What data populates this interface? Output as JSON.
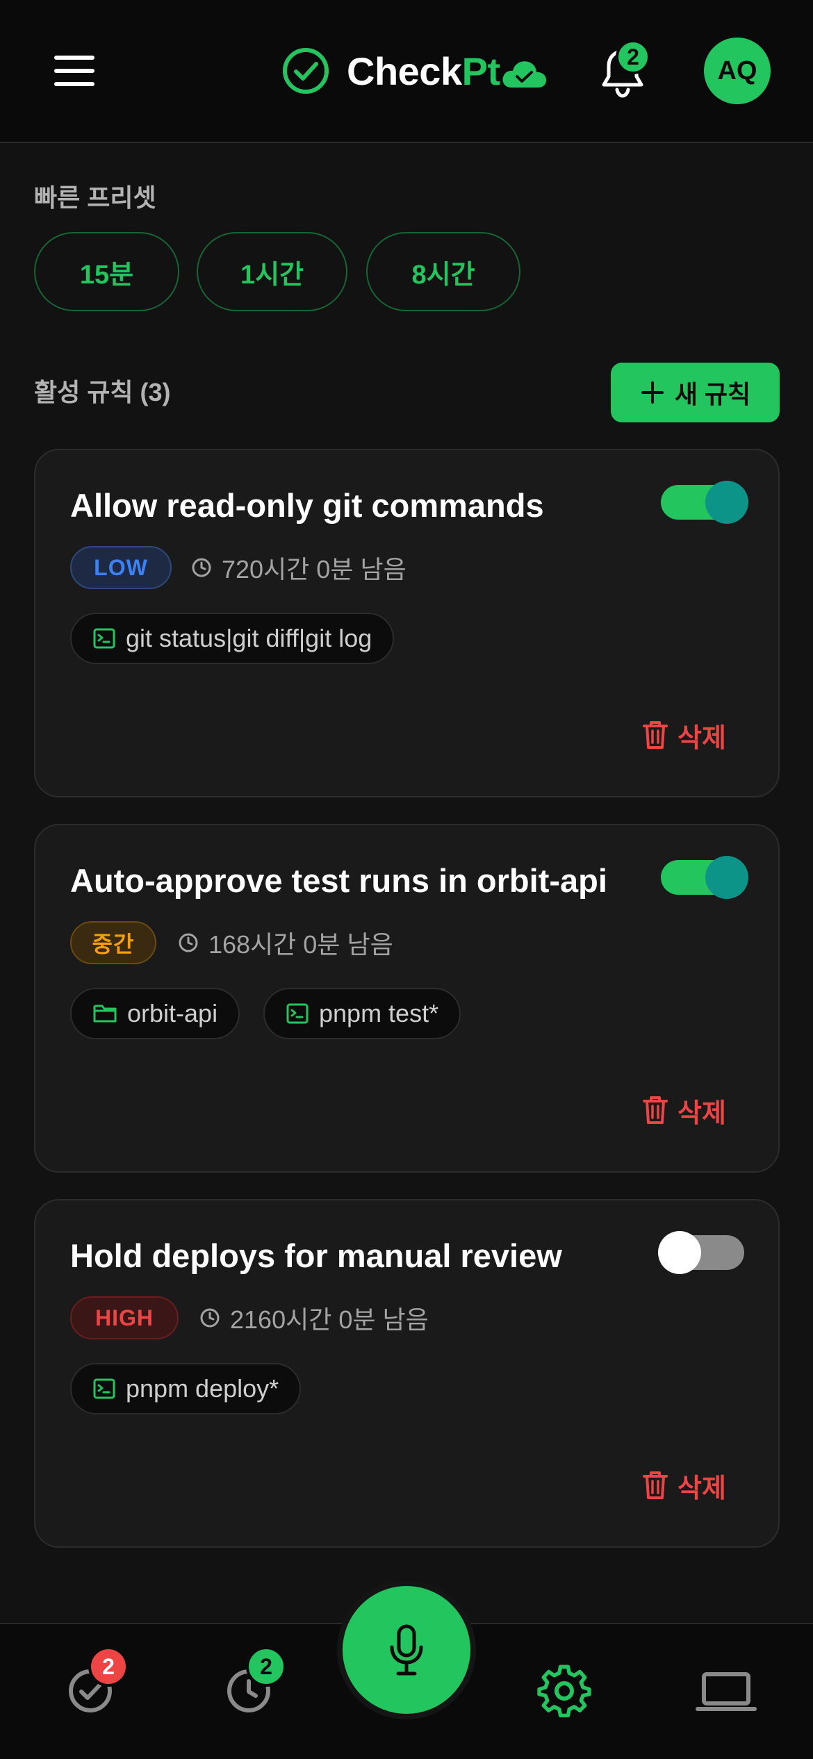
{
  "header": {
    "brand_check": "Check",
    "brand_pt": "Pt",
    "notification_count": "2",
    "avatar_initials": "AQ"
  },
  "presets": {
    "label": "빠른 프리셋",
    "items": [
      "15분",
      "1시간",
      "8시간"
    ]
  },
  "rules": {
    "label": "활성 규칙 (3)",
    "new_rule_label": "새 규칙",
    "items": [
      {
        "title": "Allow read-only git commands",
        "enabled": true,
        "risk": "LOW",
        "remaining": "720시간 0분 남음",
        "chips": [
          "git status|git diff|git log"
        ],
        "delete_label": "삭제"
      },
      {
        "title": "Auto-approve test runs in orbit-api",
        "enabled": true,
        "risk": "중간",
        "remaining": "168시간 0분 남음",
        "chips": [
          "orbit-api",
          "pnpm test*"
        ],
        "delete_label": "삭제"
      },
      {
        "title": "Hold deploys for manual review",
        "enabled": false,
        "risk": "HIGH",
        "remaining": "2160시간 0분 남음",
        "chips": [
          "pnpm deploy*"
        ],
        "delete_label": "삭제"
      }
    ]
  },
  "bottom_nav": {
    "approvals_badge": "2",
    "history_badge": "2"
  },
  "colors": {
    "accent": "#22c55e",
    "background": "#121212",
    "card": "#1a1a1a",
    "low": "#3b82f6",
    "medium": "#f59e0b",
    "high": "#ef4444",
    "toggle_knob_on": "#0d9488"
  }
}
